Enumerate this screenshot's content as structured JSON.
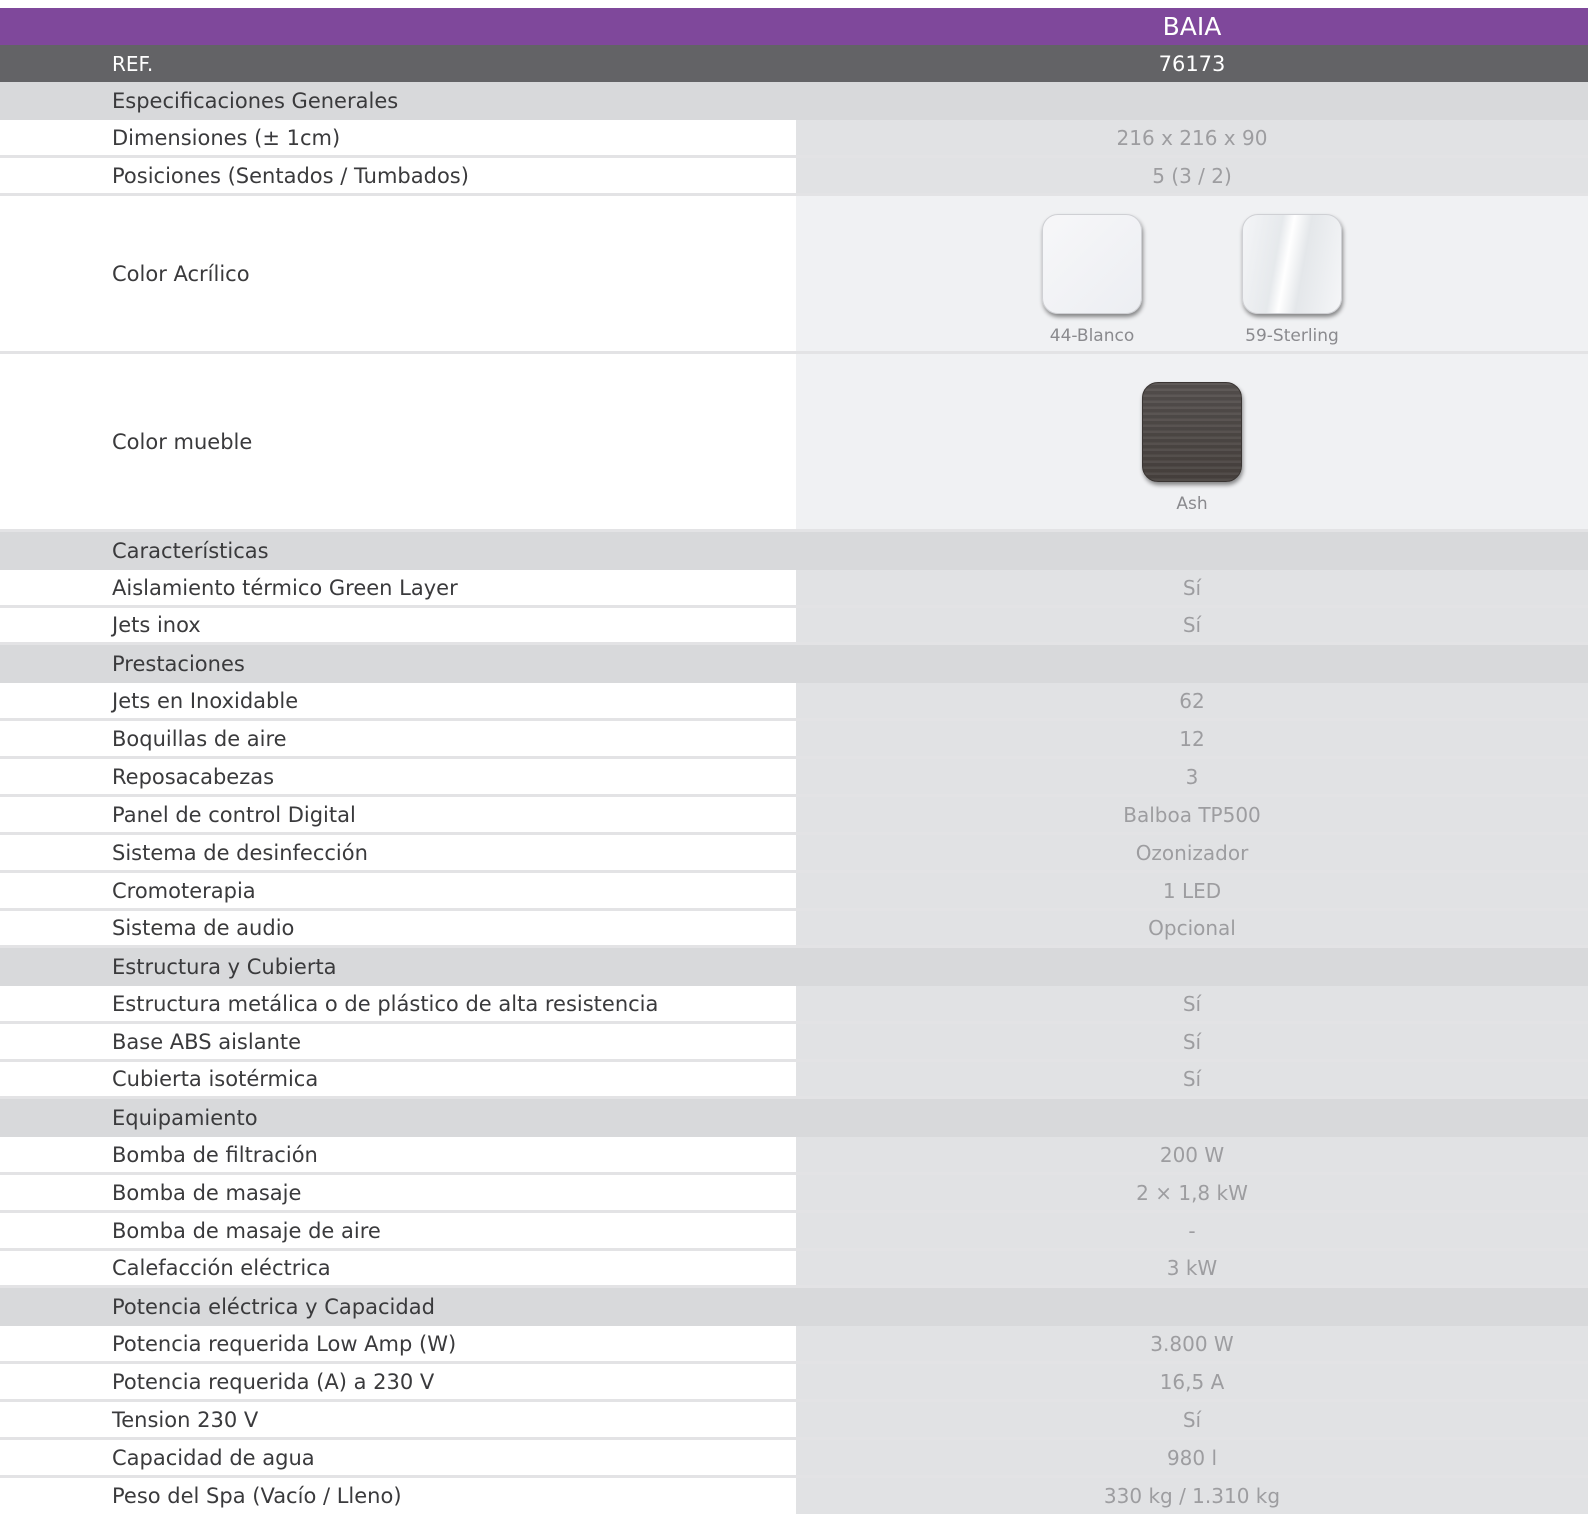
{
  "header": {
    "model": "BAIA",
    "ref_label": "REF.",
    "ref_value": "76173"
  },
  "sections": {
    "general": "Especificaciones Generales",
    "features": "Características",
    "performance": "Prestaciones",
    "structure": "Estructura y Cubierta",
    "equipment": "Equipamiento",
    "power": "Potencia eléctrica y Capacidad"
  },
  "general": [
    {
      "label": "Dimensiones (± 1cm)",
      "value": "216 x 216 x 90"
    },
    {
      "label": "Posiciones (Sentados / Tumbados)",
      "value": "5 (3 / 2)"
    }
  ],
  "acrylic": {
    "label": "Color Acrílico",
    "swatches": [
      {
        "name": "44-Blanco"
      },
      {
        "name": "59-Sterling"
      }
    ]
  },
  "cabinet": {
    "label": "Color mueble",
    "swatches": [
      {
        "name": "Ash"
      }
    ]
  },
  "features": [
    {
      "label": "Aislamiento térmico Green Layer",
      "value": "Sí"
    },
    {
      "label": "Jets inox",
      "value": "Sí"
    }
  ],
  "performance": [
    {
      "label": "Jets en Inoxidable",
      "value": "62"
    },
    {
      "label": "Boquillas de aire",
      "value": "12"
    },
    {
      "label": "Reposacabezas",
      "value": "3"
    },
    {
      "label": "Panel de control Digital",
      "value": "Balboa TP500"
    },
    {
      "label": "Sistema de desinfección",
      "value": "Ozonizador"
    },
    {
      "label": "Cromoterapia",
      "value": "1 LED"
    },
    {
      "label": "Sistema de audio",
      "value": "Opcional"
    }
  ],
  "structure": [
    {
      "label": "Estructura metálica o de plástico de alta resistencia",
      "value": "Sí"
    },
    {
      "label": "Base ABS aislante",
      "value": "Sí"
    },
    {
      "label": "Cubierta isotérmica",
      "value": "Sí"
    }
  ],
  "equipment": [
    {
      "label": "Bomba de filtración",
      "value": "200 W"
    },
    {
      "label": "Bomba de masaje",
      "value": "2 × 1,8 kW"
    },
    {
      "label": "Bomba de masaje de aire",
      "value": "-"
    },
    {
      "label": "Calefacción eléctrica",
      "value": "3 kW"
    }
  ],
  "power": [
    {
      "label": "Potencia requerida Low Amp (W)",
      "value": "3.800 W"
    },
    {
      "label": "Potencia requerida (A) a 230 V",
      "value": "16,5 A"
    },
    {
      "label": "Tension 230 V",
      "value": "Sí"
    },
    {
      "label": "Capacidad de agua",
      "value": "980 l"
    },
    {
      "label": "Peso del Spa (Vacío / Lleno)",
      "value": "330 kg / 1.310 kg"
    }
  ]
}
